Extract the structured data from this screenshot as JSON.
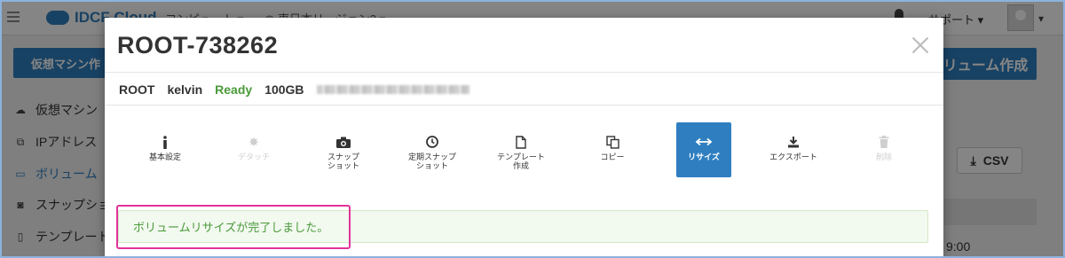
{
  "app": {
    "brand": "IDCF Cloud",
    "nav": [
      "コンピュート",
      "東日本リージョン2"
    ],
    "support_label": "サポート",
    "create_vm_label": "仮想マシン作",
    "create_volume_label": "リューム作成",
    "csv_label": "CSV",
    "time_partial": "9:00"
  },
  "sidebar": {
    "items": [
      {
        "label": "仮想マシン",
        "icon": "cloud-icon"
      },
      {
        "label": "IPアドレス",
        "icon": "network-icon"
      },
      {
        "label": "ボリューム",
        "icon": "disk-icon"
      },
      {
        "label": "スナップショ",
        "icon": "camera-icon"
      },
      {
        "label": "テンプレート",
        "icon": "file-icon"
      }
    ]
  },
  "modal": {
    "title": "ROOT-738262",
    "info": {
      "type": "ROOT",
      "vm": "kelvin",
      "status": "Ready",
      "size": "100GB"
    },
    "actions": [
      {
        "label": "基本設定",
        "icon": "info-icon",
        "state": "normal"
      },
      {
        "label": "デタッチ",
        "icon": "gear-icon",
        "state": "disabled"
      },
      {
        "label": "スナップ\nショット",
        "icon": "camera-icon",
        "state": "normal"
      },
      {
        "label": "定期スナップ\nショット",
        "icon": "clock-icon",
        "state": "normal"
      },
      {
        "label": "テンプレート\n作成",
        "icon": "file-icon",
        "state": "normal"
      },
      {
        "label": "コピー",
        "icon": "copy-icon",
        "state": "normal"
      },
      {
        "label": "リサイズ",
        "icon": "resize-icon",
        "state": "active"
      },
      {
        "label": "エクスポート",
        "icon": "download-icon",
        "state": "normal"
      },
      {
        "label": "削除",
        "icon": "trash-icon",
        "state": "disabled"
      }
    ],
    "alert_message": "ボリュームリサイズが完了しました。"
  },
  "colors": {
    "brand_blue": "#2f7fc0",
    "success_green": "#4a9a39",
    "highlight_pink": "#e2339a"
  }
}
